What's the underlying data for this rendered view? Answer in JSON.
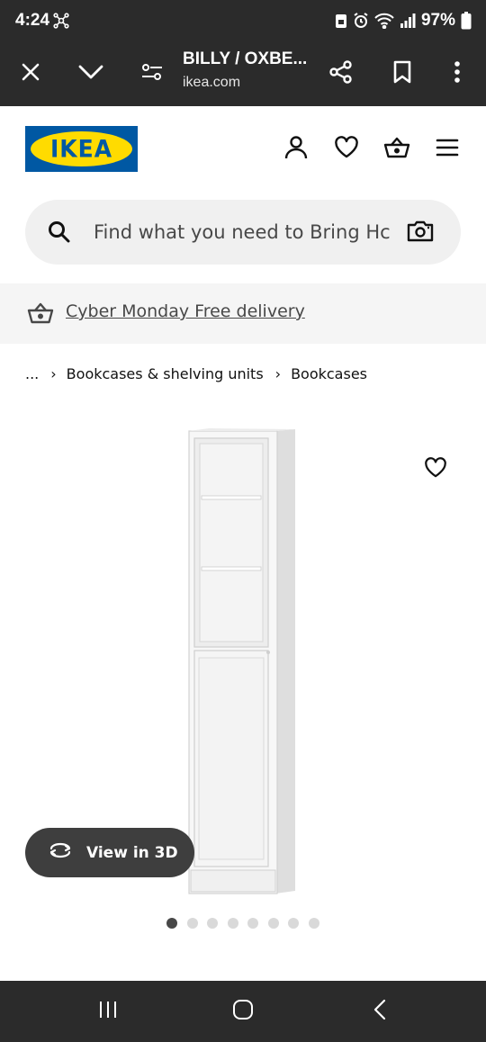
{
  "status_bar": {
    "time": "4:24",
    "battery": "97%"
  },
  "browser": {
    "page_title": "BILLY / OXBE...",
    "domain": "ikea.com"
  },
  "header": {
    "logo_text": "IKEA",
    "brand_colors": {
      "blue": "#0058a3",
      "yellow": "#ffdb00"
    }
  },
  "search": {
    "placeholder": "Find what you need to Bring Hc"
  },
  "promo": {
    "link_text": "Cyber Monday Free delivery"
  },
  "breadcrumb": {
    "items": [
      "...",
      "Bookcases & shelving units",
      "Bookcases"
    ]
  },
  "product": {
    "view_3d_label": "View in 3D",
    "carousel": {
      "total": 8,
      "active_index": 0
    }
  }
}
